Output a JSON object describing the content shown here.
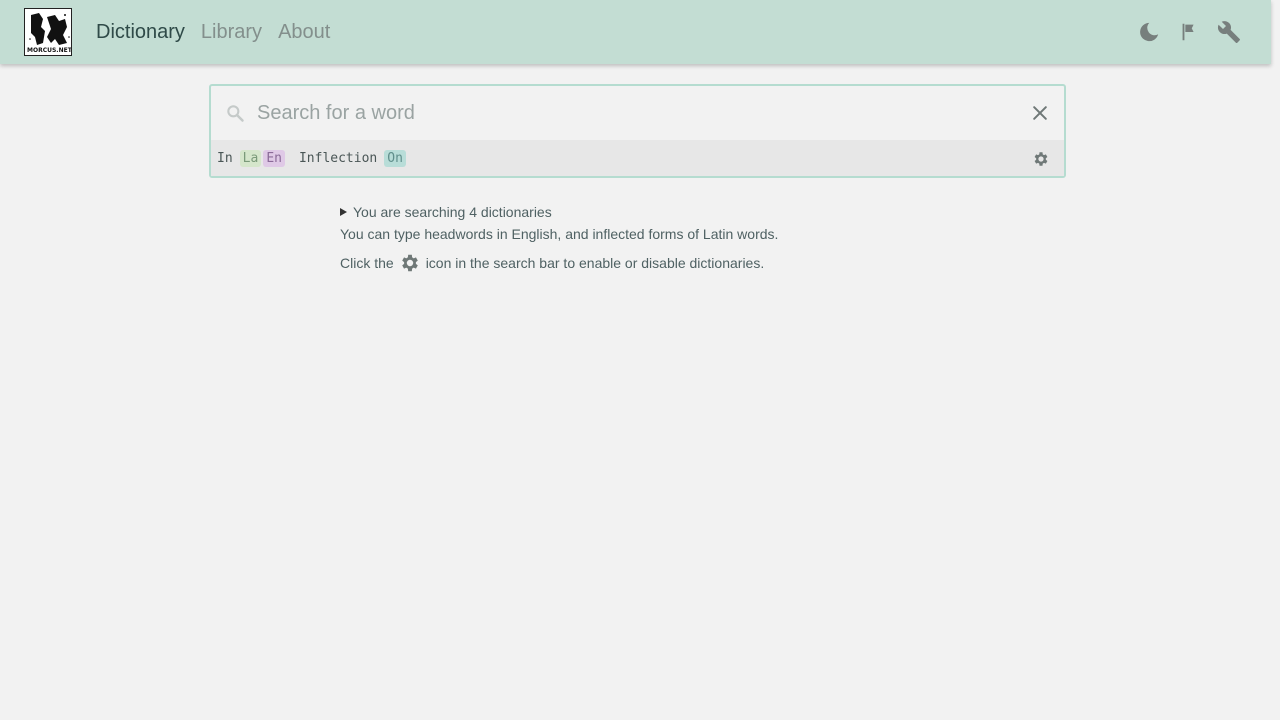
{
  "logo": {
    "text": "MORCUS.NET"
  },
  "nav": {
    "dictionary": "Dictionary",
    "library": "Library",
    "about": "About"
  },
  "tools": {
    "icons": [
      "moon-icon",
      "flag-icon",
      "wrench-icon"
    ]
  },
  "search": {
    "placeholder": "Search for a word",
    "value": ""
  },
  "settings": {
    "in_label": "In",
    "lang_la": "La",
    "lang_en": "En",
    "inflection_label": "Inflection",
    "inflection_value": "On"
  },
  "info": {
    "summary": "You are searching 4 dictionaries",
    "line2": "You can type headwords in English, and inflected forms of Latin words.",
    "line3_pre": "Click the",
    "line3_post": "icon in the search bar to enable or disable dictionaries."
  },
  "colors": {
    "topbar": "#c3ddd3",
    "background": "#f2f2f2",
    "search_border": "#b5dcd0",
    "chip_la": "#d5e6cb",
    "chip_en": "#dfc9e6",
    "chip_on": "#b8ddd8"
  }
}
